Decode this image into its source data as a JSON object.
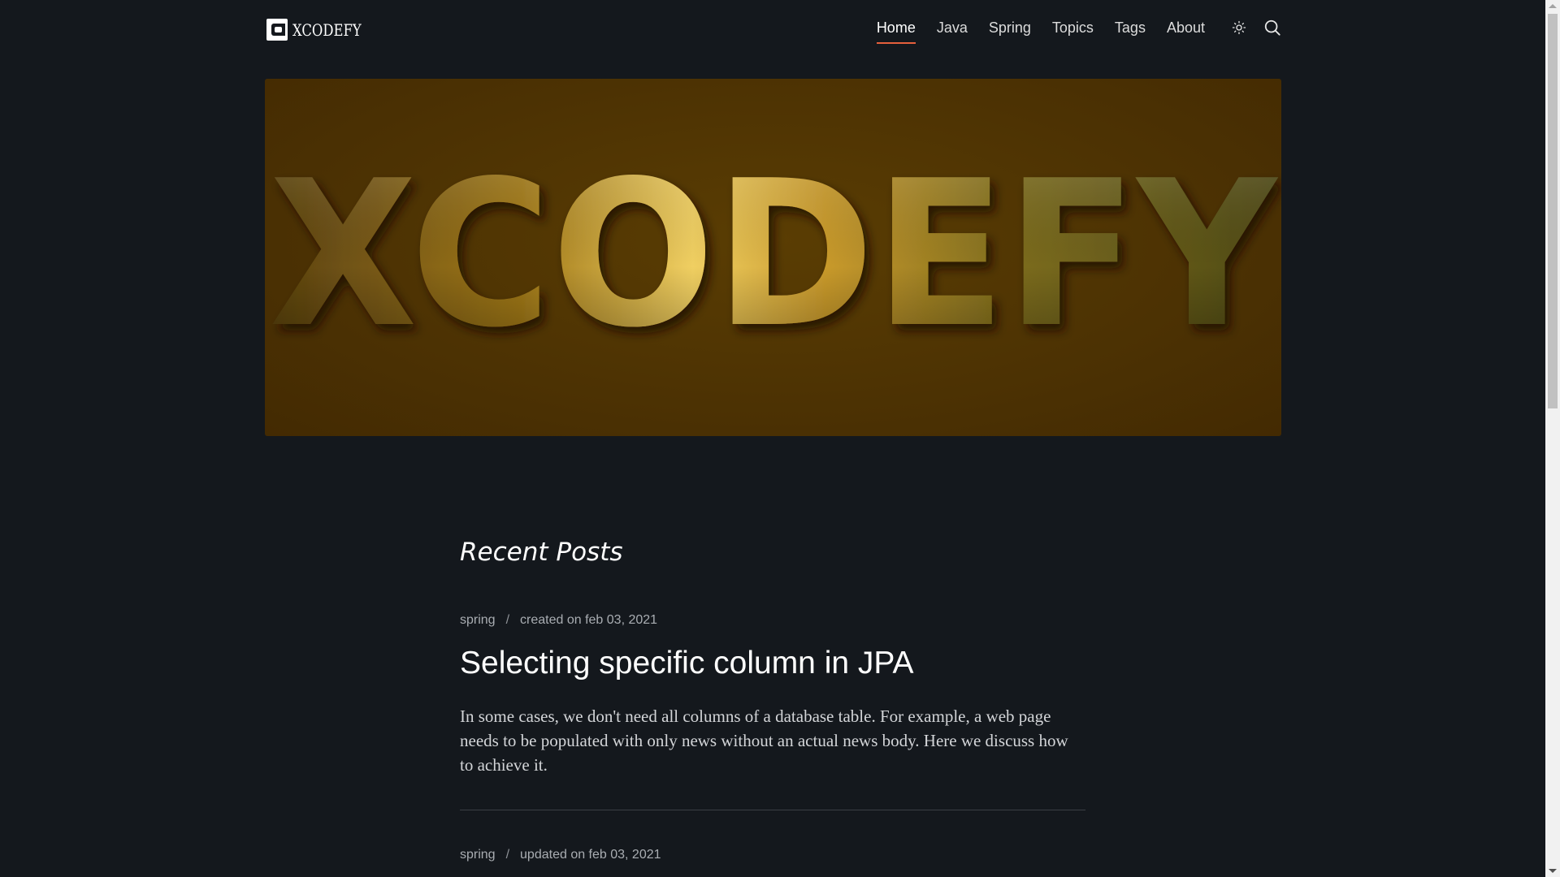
{
  "site": {
    "logo_text": "XCODEFY",
    "logo_icon": "xcodefy-logo-icon"
  },
  "nav": {
    "items": [
      {
        "label": "Home",
        "active": true
      },
      {
        "label": "Java",
        "active": false
      },
      {
        "label": "Spring",
        "active": false
      },
      {
        "label": "Topics",
        "active": false
      },
      {
        "label": "Tags",
        "active": false
      },
      {
        "label": "About",
        "active": false
      }
    ],
    "theme_toggle_icon": "sun-icon",
    "search_icon": "search-icon",
    "active_color": "#e5603c"
  },
  "hero": {
    "banner_text": "XCODEFY",
    "background_color": "#4a3003"
  },
  "main": {
    "section_title": "Recent Posts",
    "posts": [
      {
        "category": "spring",
        "separator": "/",
        "date_text": "created on feb 03, 2021",
        "title": "Selecting specific column in JPA",
        "summary": "In some cases, we don't need all columns of a database table. For example, a web page needs to be populated with only news without an actual news body. Here we discuss how to achieve it."
      },
      {
        "category": "spring",
        "separator": "/",
        "date_text": "updated on feb 03, 2021"
      }
    ]
  },
  "colors": {
    "page_background": "#14181d",
    "text_primary": "#ffffff",
    "text_meta": "#a9adb2"
  }
}
